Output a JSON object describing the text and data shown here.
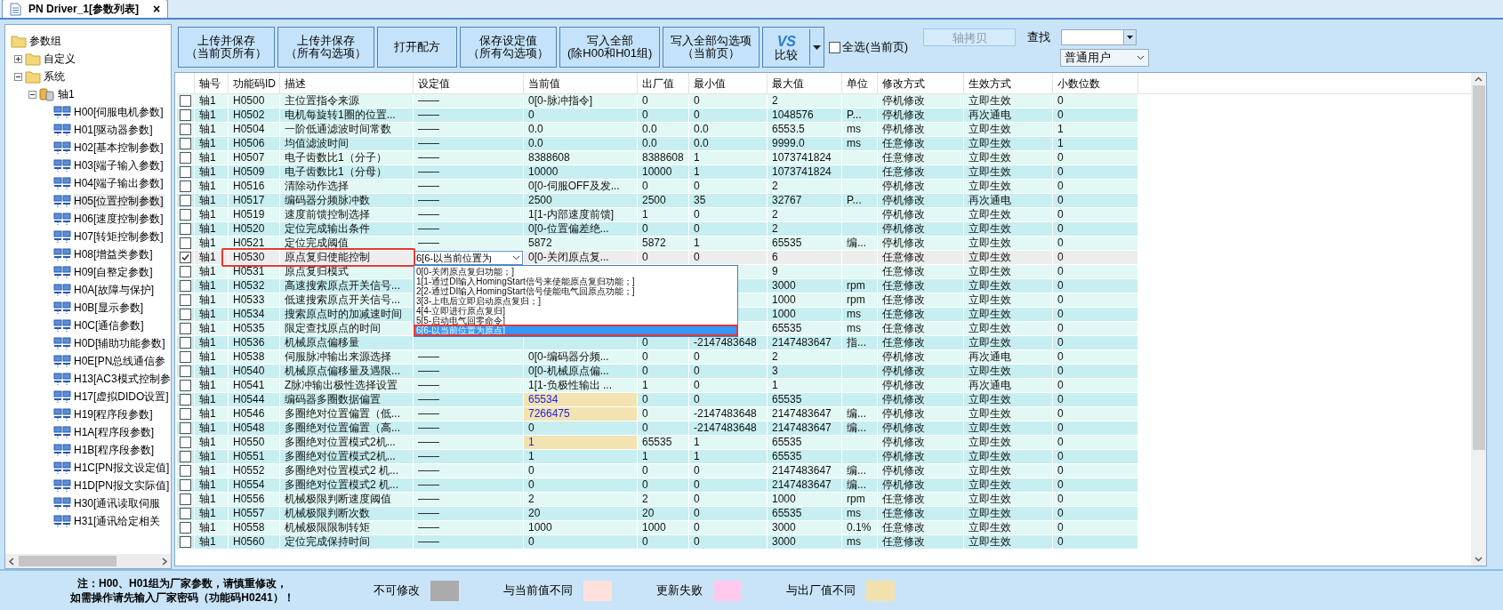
{
  "tab": {
    "title": "PN Driver_1[参数列表]",
    "close": "×",
    "selected": true
  },
  "tree": [
    {
      "label": "参数组",
      "kind": "folder",
      "children": [
        {
          "label": "自定义",
          "kind": "folder",
          "expanded": false
        },
        {
          "label": "系统",
          "kind": "folder",
          "expanded": true,
          "children": [
            {
              "label": "轴1",
              "kind": "database",
              "expanded": true,
              "children": [
                {
                  "label": "H00[伺服电机参数]",
                  "kind": "group",
                  "selected": false
                },
                {
                  "label": "H01[驱动器参数]",
                  "kind": "group",
                  "selected": false
                },
                {
                  "label": "H02[基本控制参数]",
                  "kind": "group",
                  "selected": false
                },
                {
                  "label": "H03[端子输入参数]",
                  "kind": "group",
                  "selected": false
                },
                {
                  "label": "H04[端子输出参数]",
                  "kind": "group",
                  "selected": false
                },
                {
                  "label": "H05[位置控制参数]",
                  "kind": "group",
                  "selected": true
                },
                {
                  "label": "H06[速度控制参数]",
                  "kind": "group",
                  "selected": false
                },
                {
                  "label": "H07[转矩控制参数]",
                  "kind": "group",
                  "selected": false
                },
                {
                  "label": "H08[增益类参数]",
                  "kind": "group",
                  "selected": false
                },
                {
                  "label": "H09[自整定参数]",
                  "kind": "group",
                  "selected": false
                },
                {
                  "label": "H0A[故障与保护]",
                  "kind": "group",
                  "selected": false
                },
                {
                  "label": "H0B[显示参数]",
                  "kind": "group",
                  "selected": false
                },
                {
                  "label": "H0C[通信参数]",
                  "kind": "group",
                  "selected": false
                },
                {
                  "label": "H0D[辅助功能参数]",
                  "kind": "group",
                  "selected": false
                },
                {
                  "label": "H0E[PN总线通信参",
                  "kind": "group",
                  "selected": false
                },
                {
                  "label": "H13[AC3模式控制参",
                  "kind": "group",
                  "selected": false
                },
                {
                  "label": "H17[虚拟DIDO设置]",
                  "kind": "group",
                  "selected": false
                },
                {
                  "label": "H19[程序段参数]",
                  "kind": "group",
                  "selected": false
                },
                {
                  "label": "H1A[程序段参数]",
                  "kind": "group",
                  "selected": false
                },
                {
                  "label": "H1B[程序段参数]",
                  "kind": "group",
                  "selected": false
                },
                {
                  "label": "H1C[PN报文设定值]",
                  "kind": "group",
                  "selected": false
                },
                {
                  "label": "H1D[PN报文实际值]",
                  "kind": "group",
                  "selected": false
                },
                {
                  "label": "H30[通讯读取伺服",
                  "kind": "group",
                  "selected": false
                },
                {
                  "label": "H31[通讯给定相关",
                  "kind": "group",
                  "selected": false
                }
              ]
            }
          ]
        }
      ]
    }
  ],
  "toolbar": {
    "buttons": [
      {
        "lines": [
          "上传并保存",
          "（当前页所有）"
        ]
      },
      {
        "lines": [
          "上传并保存",
          "（所有勾选项）"
        ]
      },
      {
        "lines": [
          "打开配方"
        ]
      },
      {
        "lines": [
          "保存设定值",
          "（所有勾选项）"
        ]
      },
      {
        "lines": [
          "写入全部",
          "(除H00和H01组)"
        ]
      },
      {
        "lines": [
          "写入全部勾选项",
          "（当前页）"
        ]
      }
    ],
    "compare": {
      "logo": "VS",
      "label": "比较"
    },
    "select_all": {
      "label": "全选(当前页)",
      "checked": false
    },
    "copy_axis": {
      "label": "轴拷贝",
      "disabled": true
    },
    "search": {
      "label": "查找"
    },
    "user_select": {
      "value": "普通用户"
    }
  },
  "table": {
    "columns": [
      "轴号",
      "功能码ID",
      "描述",
      "设定值",
      "当前值",
      "出厂值",
      "最小值",
      "最大值",
      "单位",
      "修改方式",
      "生效方式",
      "小数位数"
    ],
    "rows": [
      {
        "checked": false,
        "selected": false,
        "factory_diff": false,
        "axis": "轴1",
        "id": "H0500",
        "desc": "主位置指令来源",
        "setting": "——",
        "current": "0[0-脉冲指令]",
        "factory": "0",
        "min": "0",
        "max": "2",
        "modify": "停机修改",
        "effect": "立即生效",
        "decimals": "0"
      },
      {
        "checked": false,
        "selected": false,
        "factory_diff": false,
        "axis": "轴1",
        "id": "H0502",
        "desc": "电机每旋转1圈的位置...",
        "setting": "——",
        "current": "0",
        "factory": "0",
        "min": "0",
        "max": "1048576",
        "unit": "P...",
        "modify": "停机修改",
        "effect": "再次通电",
        "decimals": "0"
      },
      {
        "checked": false,
        "selected": false,
        "factory_diff": false,
        "axis": "轴1",
        "id": "H0504",
        "desc": "一阶低通滤波时间常数",
        "setting": "——",
        "current": "0.0",
        "factory": "0.0",
        "min": "0.0",
        "max": "6553.5",
        "unit": "ms",
        "modify": "停机修改",
        "effect": "立即生效",
        "decimals": "1"
      },
      {
        "checked": false,
        "selected": false,
        "factory_diff": false,
        "axis": "轴1",
        "id": "H0506",
        "desc": "均值滤波时间",
        "setting": "——",
        "current": "0.0",
        "factory": "0.0",
        "min": "0.0",
        "max": "9999.0",
        "unit": "ms",
        "modify": "任意修改",
        "effect": "立即生效",
        "decimals": "1"
      },
      {
        "checked": false,
        "selected": false,
        "factory_diff": false,
        "axis": "轴1",
        "id": "H0507",
        "desc": "电子齿数比1（分子）",
        "setting": "——",
        "current": "8388608",
        "factory": "8388608",
        "min": "1",
        "max": "1073741824",
        "modify": "任意修改",
        "effect": "立即生效",
        "decimals": "0"
      },
      {
        "checked": false,
        "selected": false,
        "factory_diff": false,
        "axis": "轴1",
        "id": "H0509",
        "desc": "电子齿数比1（分母）",
        "setting": "——",
        "current": "10000",
        "factory": "10000",
        "min": "1",
        "max": "1073741824",
        "modify": "任意修改",
        "effect": "立即生效",
        "decimals": "0"
      },
      {
        "checked": false,
        "selected": false,
        "factory_diff": false,
        "axis": "轴1",
        "id": "H0516",
        "desc": "清除动作选择",
        "setting": "——",
        "current": "0[0-伺服OFF及发...",
        "factory": "0",
        "min": "0",
        "max": "2",
        "modify": "停机修改",
        "effect": "立即生效",
        "decimals": "0"
      },
      {
        "checked": false,
        "selected": false,
        "factory_diff": false,
        "axis": "轴1",
        "id": "H0517",
        "desc": "编码器分频脉冲数",
        "setting": "——",
        "current": "2500",
        "factory": "2500",
        "min": "35",
        "max": "32767",
        "unit": "P...",
        "modify": "停机修改",
        "effect": "再次通电",
        "decimals": "0"
      },
      {
        "checked": false,
        "selected": false,
        "factory_diff": false,
        "axis": "轴1",
        "id": "H0519",
        "desc": "速度前馈控制选择",
        "setting": "——",
        "current": "1[1-内部速度前馈]",
        "factory": "1",
        "min": "0",
        "max": "2",
        "modify": "停机修改",
        "effect": "立即生效",
        "decimals": "0"
      },
      {
        "checked": false,
        "selected": false,
        "factory_diff": false,
        "axis": "轴1",
        "id": "H0520",
        "desc": "定位完成输出条件",
        "setting": "——",
        "current": "0[0-位置偏差绝...",
        "factory": "0",
        "min": "0",
        "max": "2",
        "modify": "停机修改",
        "effect": "立即生效",
        "decimals": "0"
      },
      {
        "checked": false,
        "selected": false,
        "factory_diff": false,
        "axis": "轴1",
        "id": "H0521",
        "desc": "定位完成阈值",
        "setting": "——",
        "current": "5872",
        "factory": "5872",
        "min": "1",
        "max": "65535",
        "unit": "编...",
        "modify": "停机修改",
        "effect": "立即生效",
        "decimals": "0"
      },
      {
        "checked": true,
        "selected": true,
        "factory_diff": false,
        "axis": "轴1",
        "id": "H0530",
        "desc": "原点复归使能控制",
        "setting_select": {
          "value": "6[6-以当前位置为",
          "expanded": true,
          "options": [
            {
              "label": "0[0-关闭原点复归功能；]",
              "selected": false
            },
            {
              "label": "1[1-通过DI输入HomingStart信号来使能原点复归功能；]",
              "selected": false
            },
            {
              "label": "2[2-通过DI输入HomingStart信号使能电气回原点功能；]",
              "selected": false
            },
            {
              "label": "3[3-上电后立即启动原点复归；]",
              "selected": false
            },
            {
              "label": "4[4-立即进行原点复归]",
              "selected": false
            },
            {
              "label": "5[5-启动电气回零命令]",
              "selected": false
            },
            {
              "label": "6[6-以当前位置为原点]",
              "selected": true
            }
          ]
        },
        "current": "0[0-关闭原点复...",
        "factory": "0",
        "min": "0",
        "max": "6",
        "modify": "任意修改",
        "effect": "立即生效",
        "decimals": "0"
      },
      {
        "checked": false,
        "selected": false,
        "axis": "轴1",
        "id": "H0531",
        "desc": "原点复归模式",
        "max": "9",
        "modify": "任意修改",
        "effect": "立即生效",
        "decimals": "0"
      },
      {
        "checked": false,
        "selected": false,
        "axis": "轴1",
        "id": "H0532",
        "desc": "高速搜索原点开关信号...",
        "max": "3000",
        "unit": "rpm",
        "modify": "任意修改",
        "effect": "立即生效",
        "decimals": "0"
      },
      {
        "checked": false,
        "selected": false,
        "axis": "轴1",
        "id": "H0533",
        "desc": "低速搜索原点开关信号...",
        "max": "1000",
        "unit": "rpm",
        "modify": "任意修改",
        "effect": "立即生效",
        "decimals": "0"
      },
      {
        "checked": false,
        "selected": false,
        "axis": "轴1",
        "id": "H0534",
        "desc": "搜索原点时的加减速时间",
        "max": "1000",
        "unit": "ms",
        "modify": "任意修改",
        "effect": "立即生效",
        "decimals": "0"
      },
      {
        "checked": false,
        "selected": false,
        "axis": "轴1",
        "id": "H0535",
        "desc": "限定查找原点的时间",
        "max": "65535",
        "unit": "ms",
        "modify": "任意修改",
        "effect": "立即生效",
        "decimals": "0"
      },
      {
        "checked": false,
        "selected": false,
        "axis": "轴1",
        "id": "H0536",
        "desc": "机械原点偏移量",
        "factory": "0",
        "min": "-2147483648",
        "max": "2147483647",
        "unit": "指...",
        "modify": "任意修改",
        "effect": "立即生效",
        "decimals": "0"
      },
      {
        "checked": false,
        "selected": false,
        "factory_diff": false,
        "axis": "轴1",
        "id": "H0538",
        "desc": "伺服脉冲输出来源选择",
        "setting": "——",
        "current": "0[0-编码器分频...",
        "factory": "0",
        "min": "0",
        "max": "2",
        "modify": "停机修改",
        "effect": "再次通电",
        "decimals": "0"
      },
      {
        "checked": false,
        "selected": false,
        "factory_diff": false,
        "axis": "轴1",
        "id": "H0540",
        "desc": "机械原点偏移量及遇限...",
        "setting": "——",
        "current": "0[0-机械原点偏...",
        "factory": "0",
        "min": "0",
        "max": "3",
        "modify": "停机修改",
        "effect": "立即生效",
        "decimals": "0"
      },
      {
        "checked": false,
        "selected": false,
        "factory_diff": false,
        "axis": "轴1",
        "id": "H0541",
        "desc": "Z脉冲输出极性选择设置",
        "setting": "——",
        "current": "1[1-负极性输出 ...",
        "factory": "1",
        "min": "0",
        "max": "1",
        "modify": "停机修改",
        "effect": "再次通电",
        "decimals": "0"
      },
      {
        "checked": false,
        "selected": false,
        "factory_diff": true,
        "axis": "轴1",
        "id": "H0544",
        "desc": "编码器多圈数据偏置",
        "setting": "——",
        "current": "65534",
        "factory": "0",
        "min": "0",
        "max": "65535",
        "modify": "停机修改",
        "effect": "立即生效",
        "decimals": "0"
      },
      {
        "checked": false,
        "selected": false,
        "factory_diff": true,
        "axis": "轴1",
        "id": "H0546",
        "desc": "多圈绝对位置偏置（低...",
        "setting": "——",
        "current": "7266475",
        "factory": "0",
        "min": "-2147483648",
        "max": "2147483647",
        "unit": "编...",
        "modify": "停机修改",
        "effect": "立即生效",
        "decimals": "0"
      },
      {
        "checked": false,
        "selected": false,
        "factory_diff": false,
        "axis": "轴1",
        "id": "H0548",
        "desc": "多圈绝对位置偏置（高...",
        "setting": "——",
        "current": "0",
        "factory": "0",
        "min": "-2147483648",
        "max": "2147483647",
        "unit": "编...",
        "modify": "停机修改",
        "effect": "立即生效",
        "decimals": "0"
      },
      {
        "checked": false,
        "selected": false,
        "factory_diff": true,
        "axis": "轴1",
        "id": "H0550",
        "desc": "多圈绝对位置模式2机...",
        "setting": "——",
        "current": "1",
        "factory": "65535",
        "min": "1",
        "max": "65535",
        "modify": "停机修改",
        "effect": "立即生效",
        "decimals": "0"
      },
      {
        "checked": false,
        "selected": false,
        "factory_diff": false,
        "axis": "轴1",
        "id": "H0551",
        "desc": "多圈绝对位置模式2机...",
        "setting": "——",
        "current": "1",
        "factory": "1",
        "min": "1",
        "max": "65535",
        "modify": "停机修改",
        "effect": "立即生效",
        "decimals": "0"
      },
      {
        "checked": false,
        "selected": false,
        "factory_diff": false,
        "axis": "轴1",
        "id": "H0552",
        "desc": "多圈绝对位置模式2 机...",
        "setting": "——",
        "current": "0",
        "factory": "0",
        "min": "0",
        "max": "2147483647",
        "unit": "编...",
        "modify": "停机修改",
        "effect": "立即生效",
        "decimals": "0"
      },
      {
        "checked": false,
        "selected": false,
        "factory_diff": false,
        "axis": "轴1",
        "id": "H0554",
        "desc": "多圈绝对位置模式2 机...",
        "setting": "——",
        "current": "0",
        "factory": "0",
        "min": "0",
        "max": "2147483647",
        "unit": "编...",
        "modify": "停机修改",
        "effect": "立即生效",
        "decimals": "0"
      },
      {
        "checked": false,
        "selected": false,
        "factory_diff": false,
        "axis": "轴1",
        "id": "H0556",
        "desc": "机械极限判断速度阈值",
        "setting": "——",
        "current": "2",
        "factory": "2",
        "min": "0",
        "max": "1000",
        "unit": "rpm",
        "modify": "任意修改",
        "effect": "立即生效",
        "decimals": "0"
      },
      {
        "checked": false,
        "selected": false,
        "factory_diff": false,
        "axis": "轴1",
        "id": "H0557",
        "desc": "机械极限判断次数",
        "setting": "——",
        "current": "20",
        "factory": "20",
        "min": "0",
        "max": "65535",
        "unit": "ms",
        "modify": "任意修改",
        "effect": "立即生效",
        "decimals": "0"
      },
      {
        "checked": false,
        "selected": false,
        "factory_diff": false,
        "axis": "轴1",
        "id": "H0558",
        "desc": "机械极限限制转矩",
        "setting": "——",
        "current": "1000",
        "factory": "1000",
        "min": "0",
        "max": "3000",
        "unit": "0.1%",
        "modify": "任意修改",
        "effect": "立即生效",
        "decimals": "0"
      },
      {
        "checked": false,
        "selected": false,
        "factory_diff": false,
        "axis": "轴1",
        "id": "H0560",
        "desc": "定位完成保持时间",
        "setting": "——",
        "current": "0",
        "factory": "0",
        "min": "0",
        "max": "3000",
        "unit": "ms",
        "modify": "任意修改",
        "effect": "立即生效",
        "decimals": "0"
      }
    ]
  },
  "legend": {
    "note": [
      "注：H00、H01组为厂家参数，请慎重修改，",
      "如需操作请先输入厂家密码（功能码H0241）！"
    ],
    "items": [
      {
        "label": "不可修改",
        "color": "#ababab"
      },
      {
        "label": "与当前值不同",
        "color": "#ffe1dc"
      },
      {
        "label": "更新失败",
        "color": "#ffc9ee"
      },
      {
        "label": "与出厂值不同",
        "color": "#f1e2ad"
      }
    ]
  }
}
